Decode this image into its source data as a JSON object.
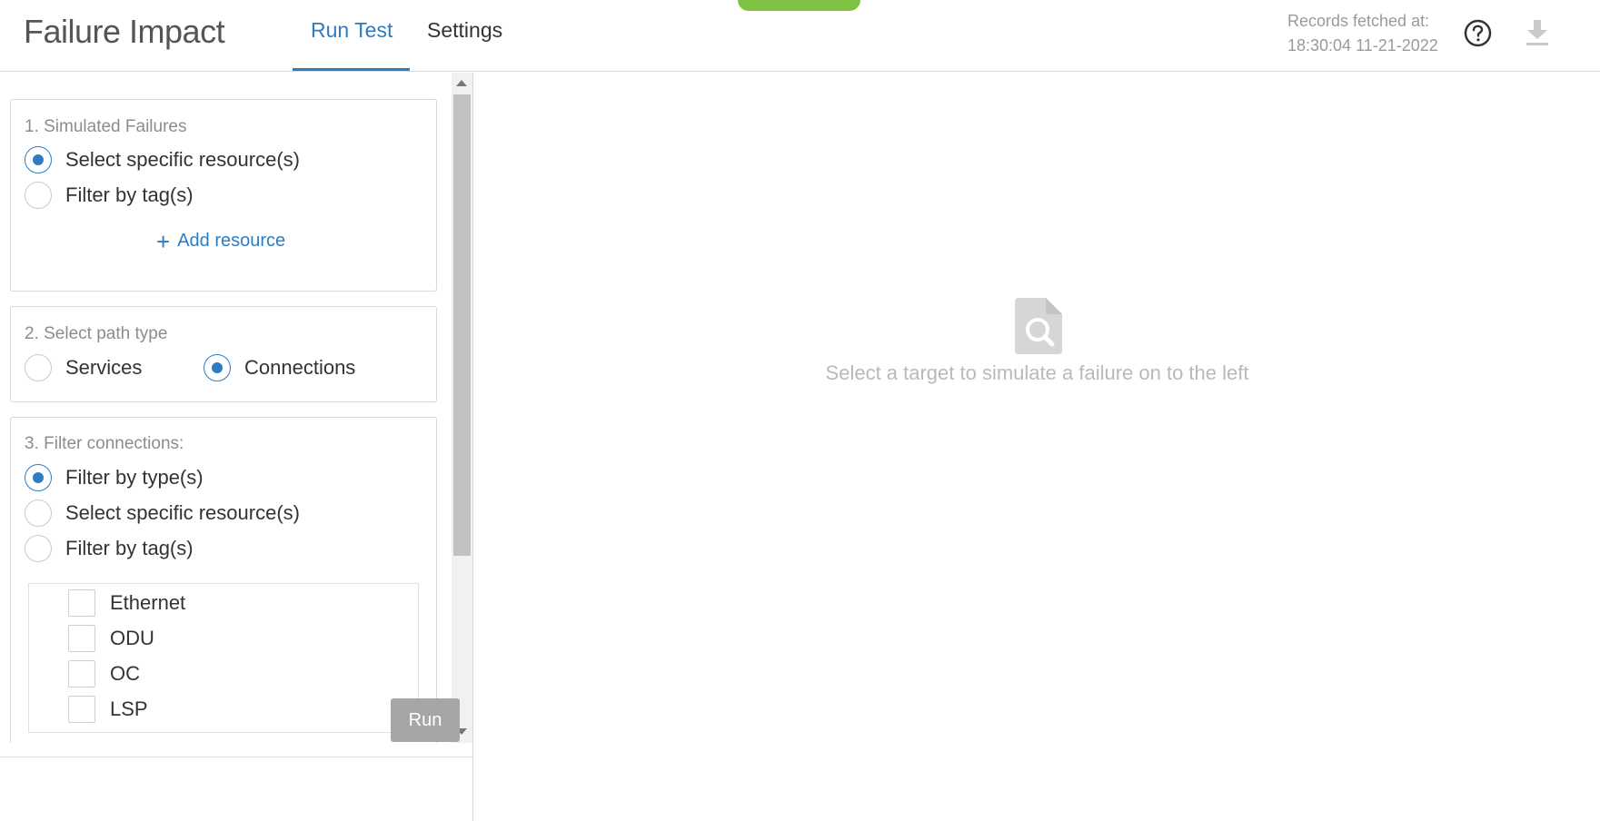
{
  "header": {
    "title": "Failure Impact",
    "tabs": [
      {
        "label": "Run Test",
        "active": true
      },
      {
        "label": "Settings",
        "active": false
      }
    ],
    "records_fetched_label": "Records fetched at:",
    "records_fetched_time": "18:30:04 11-21-2022",
    "help_icon": "question-circle-icon",
    "download_icon": "download-icon"
  },
  "simulated_failures": {
    "title": "1. Simulated Failures",
    "options": [
      {
        "label": "Select specific resource(s)",
        "checked": true
      },
      {
        "label": "Filter by tag(s)",
        "checked": false
      }
    ],
    "add_resource_label": "Add resource"
  },
  "path_type": {
    "title": "2. Select path type",
    "options": [
      {
        "label": "Services",
        "checked": false
      },
      {
        "label": "Connections",
        "checked": true
      }
    ]
  },
  "filter_connections": {
    "title": "3. Filter connections:",
    "options": [
      {
        "label": "Filter by type(s)",
        "checked": true
      },
      {
        "label": "Select specific resource(s)",
        "checked": false
      },
      {
        "label": "Filter by tag(s)",
        "checked": false
      }
    ],
    "types": [
      {
        "label": "Ethernet",
        "checked": false
      },
      {
        "label": "ODU",
        "checked": false
      },
      {
        "label": "OC",
        "checked": false
      },
      {
        "label": "LSP",
        "checked": false
      }
    ]
  },
  "footer": {
    "run_label": "Run"
  },
  "empty_state": {
    "icon": "document-search-icon",
    "message": "Select a target to simulate a failure on to the left"
  },
  "colors": {
    "accent": "#2d7cc1",
    "green_pill": "#7dc243",
    "disabled_button": "#a6a6a6"
  }
}
